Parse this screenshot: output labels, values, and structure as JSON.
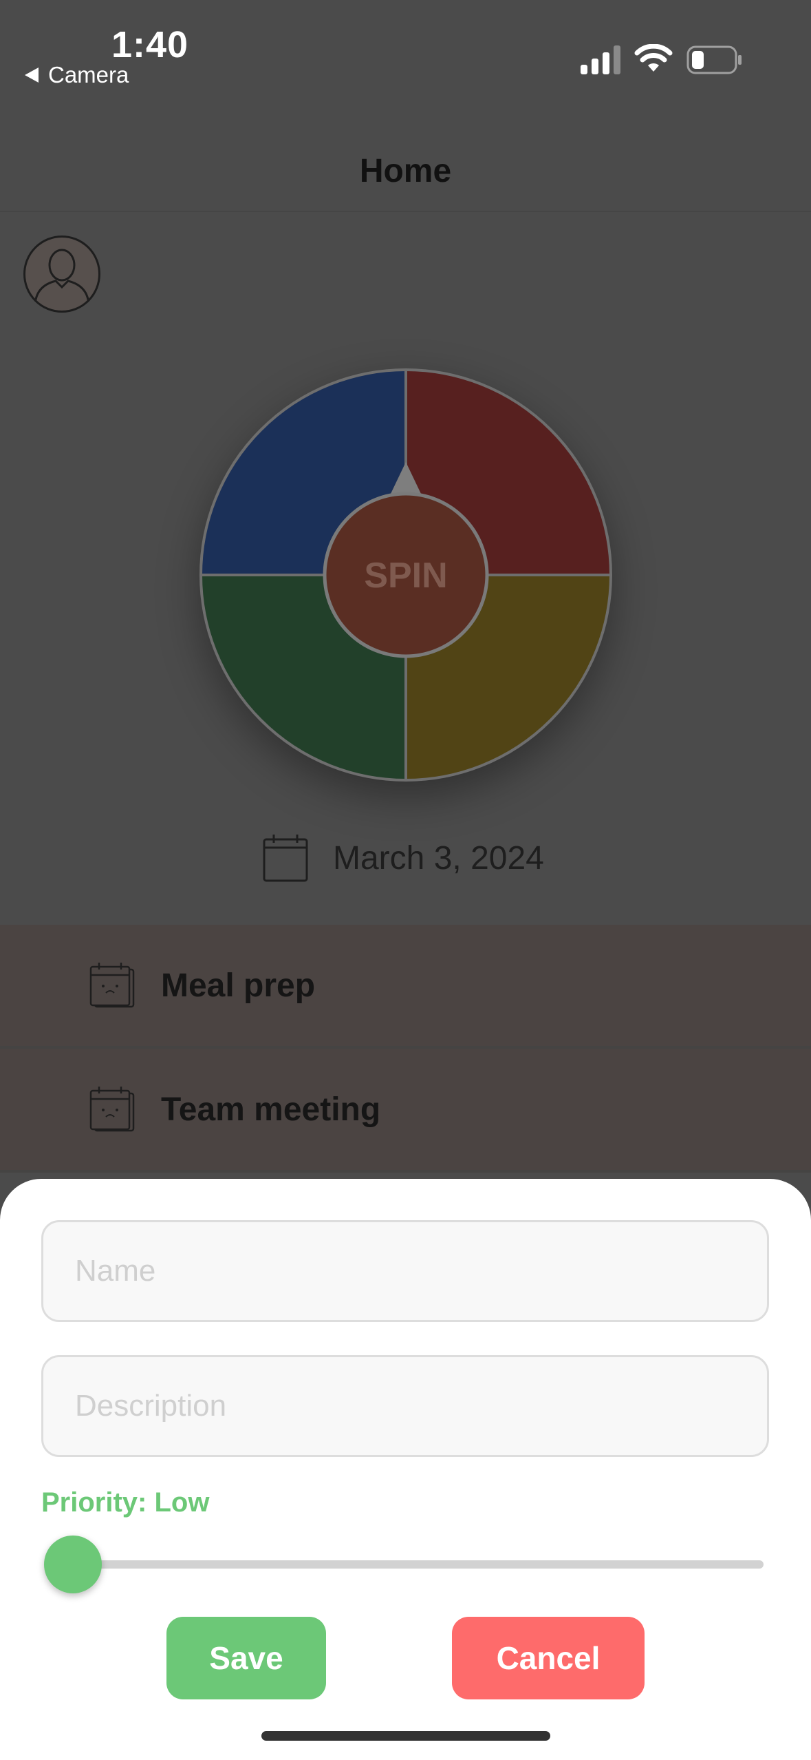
{
  "status_bar": {
    "time": "1:40",
    "back_label": "Camera"
  },
  "nav": {
    "title": "Home"
  },
  "wheel": {
    "center_label": "SPIN",
    "colors": {
      "top_left": "#1b3058",
      "top_right": "#57201f",
      "bottom_left": "#22402a",
      "bottom_right": "#514415",
      "center": "#5a2e23"
    }
  },
  "date": {
    "text": "March 3, 2024",
    "icon": "calendar-icon"
  },
  "tasks": [
    {
      "label": "Meal prep",
      "icon": "calendar-sad-icon"
    },
    {
      "label": "Team meeting",
      "icon": "calendar-sad-icon"
    }
  ],
  "sheet": {
    "name_placeholder": "Name",
    "description_placeholder": "Description",
    "priority_prefix": "Priority:",
    "priority_value": "Low",
    "priority_level": 0,
    "save_label": "Save",
    "cancel_label": "Cancel",
    "accent_color": "#6cc877",
    "cancel_color": "#fe6b6b"
  }
}
